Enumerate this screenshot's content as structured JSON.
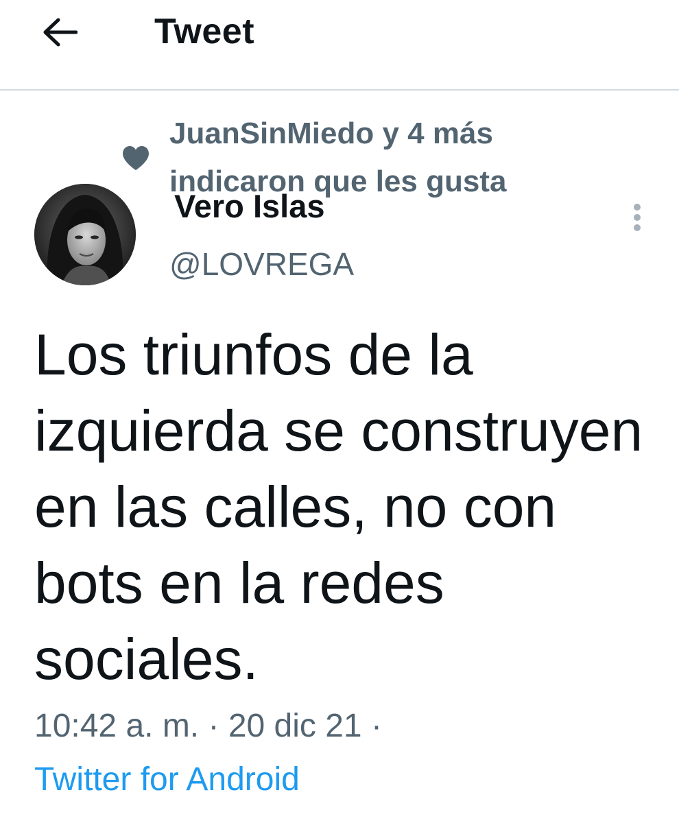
{
  "header": {
    "title": "Tweet",
    "back_icon": "arrow-left-icon"
  },
  "social_context": {
    "icon": "heart-icon",
    "text": "JuanSinMiedo y 4 más indicaron que les gusta"
  },
  "author": {
    "display_name": "Vero Islas",
    "handle": "@LOVREGA"
  },
  "tweet": {
    "text": "Los triunfos de la izquierda se construyen en las calles, no con bots en la redes sociales.",
    "time": "10:42 a. m.",
    "separator": "·",
    "date": "20 dic 21",
    "source": "Twitter for Android"
  },
  "colors": {
    "text_primary": "#0f1419",
    "text_secondary": "#536471",
    "link": "#1d9bf0",
    "divider": "#cfd9de"
  }
}
